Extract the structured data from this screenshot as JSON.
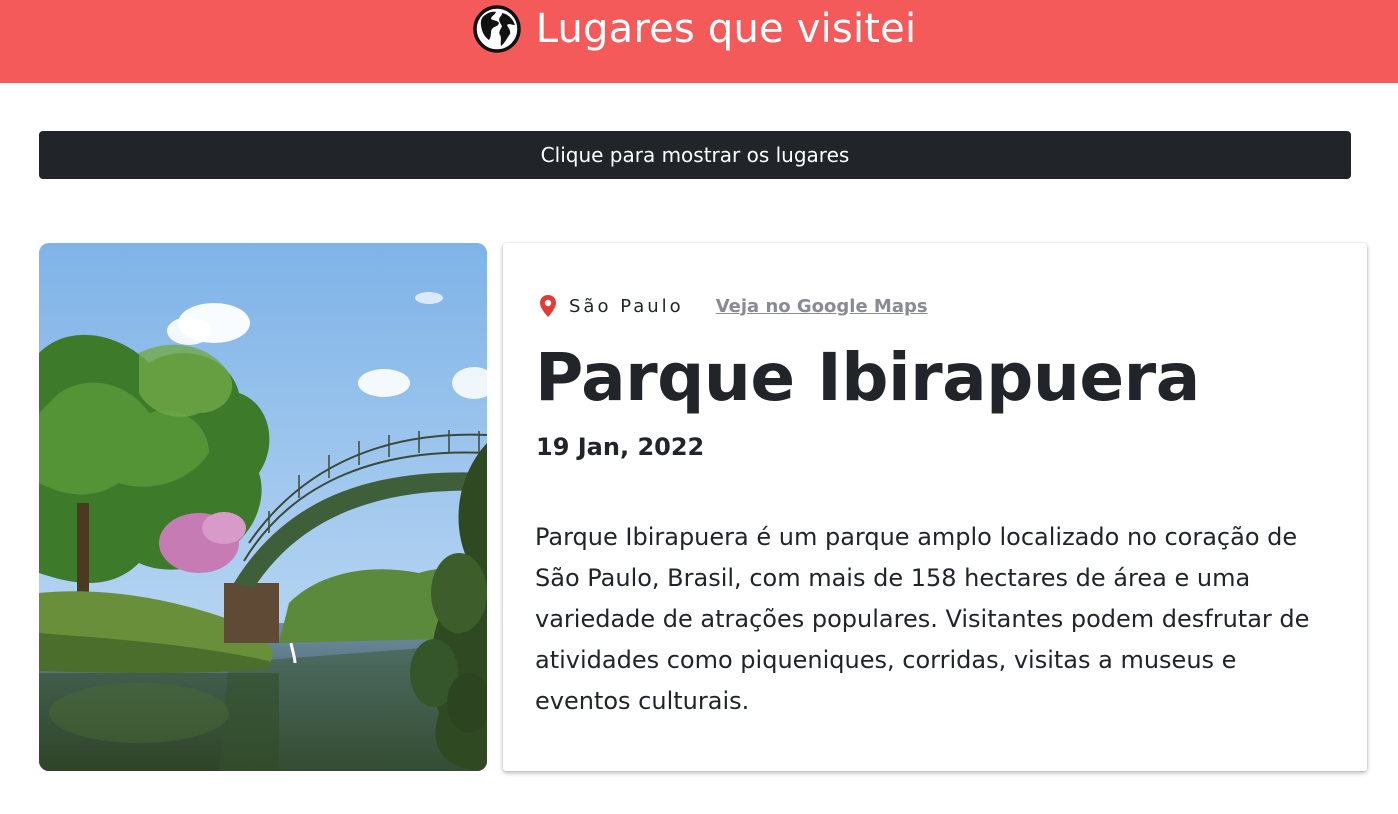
{
  "header": {
    "icon": "globe-icon",
    "title": "Lugares que visitei",
    "background": "#f55a5a"
  },
  "toolbar": {
    "show_places_label": "Clique para mostrar os lugares"
  },
  "place": {
    "image_subject": "park-bridge-over-lake-photo",
    "location_icon": "map-pin-icon",
    "location": "São Paulo",
    "maps_link_label": "Veja no Google Maps",
    "title": "Parque Ibirapuera",
    "date": "19 Jan, 2022",
    "description": "Parque Ibirapuera é um parque amplo localizado no coração de São Paulo, Brasil, com mais de 158 hectares de área e uma variedade de atrações populares. Visitantes podem desfrutar de atividades como piqueniques, corridas, visitas a museus e eventos culturais."
  },
  "colors": {
    "accent": "#f55a5a",
    "button": "#212529",
    "pin": "#e53935",
    "link": "#8a8a94"
  }
}
